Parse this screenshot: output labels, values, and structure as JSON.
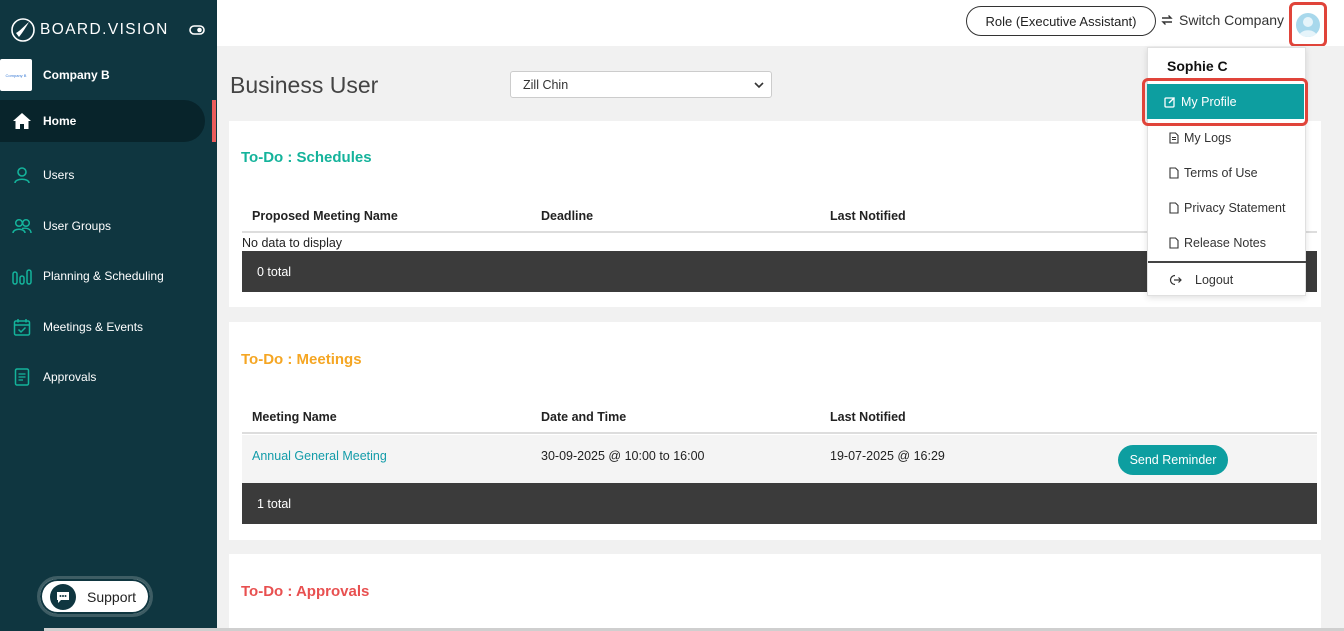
{
  "brand": {
    "name": "BOARD.VISION"
  },
  "company": {
    "logo_text": "Company B",
    "name": "Company B"
  },
  "sidebar": {
    "items": [
      {
        "label": "Home",
        "icon": "home-icon",
        "active": true
      },
      {
        "label": "Users",
        "icon": "user-icon",
        "active": false
      },
      {
        "label": "User Groups",
        "icon": "user-groups-icon",
        "active": false
      },
      {
        "label": "Planning & Scheduling",
        "icon": "bar-chart-icon",
        "active": false
      },
      {
        "label": "Meetings & Events",
        "icon": "calendar-check-icon",
        "active": false
      },
      {
        "label": "Approvals",
        "icon": "document-icon",
        "active": false
      }
    ],
    "support_label": "Support"
  },
  "topbar": {
    "role_label": "Role (Executive Assistant)",
    "switch_company_label": "Switch Company"
  },
  "main": {
    "title": "Business User",
    "user_select_value": "Zill Chin"
  },
  "schedules": {
    "title": "To-Do : Schedules",
    "columns": [
      "Proposed Meeting Name",
      "Deadline",
      "Last Notified"
    ],
    "empty_text": "No data to display",
    "total": "0 total"
  },
  "meetings": {
    "title": "To-Do : Meetings",
    "columns": [
      "Meeting Name",
      "Date and Time",
      "Last Notified"
    ],
    "rows": [
      {
        "name": "Annual General Meeting",
        "datetime": "30-09-2025 @ 10:00 to 16:00",
        "last_notified": "19-07-2025 @ 16:29",
        "action": "Send Reminder"
      }
    ],
    "total": "1 total"
  },
  "approvals": {
    "title": "To-Do : Approvals"
  },
  "dropdown": {
    "user_name": "Sophie C",
    "items": [
      {
        "label": "My Profile",
        "icon": "edit-icon",
        "active": true
      },
      {
        "label": "My Logs",
        "icon": "file-text-icon"
      },
      {
        "label": "Terms of Use",
        "icon": "file-icon"
      },
      {
        "label": "Privacy Statement",
        "icon": "file-icon"
      },
      {
        "label": "Release Notes",
        "icon": "file-icon"
      }
    ],
    "logout_label": "Logout"
  },
  "colors": {
    "sidebar_bg": "#0f3640",
    "accent_teal": "#0d9ea0",
    "schedules_title": "#14b39b",
    "meetings_title": "#f5a623",
    "approvals_title": "#e85050",
    "highlight": "#e0443a"
  }
}
